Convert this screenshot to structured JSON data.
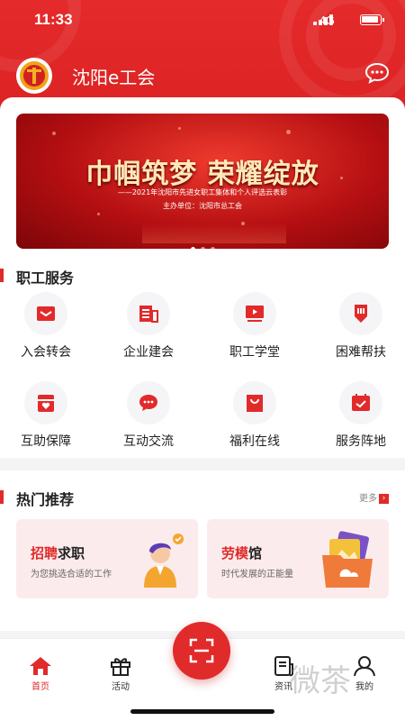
{
  "status_bar": {
    "time": "11:33",
    "network": "4G"
  },
  "header": {
    "title": "沈阳e工会",
    "icon": "message-icon"
  },
  "banner": {
    "headline": "巾帼筑梦 荣耀绽放",
    "subtitle": "——2021年沈阳市先进女职工集体和个人评选云表彰",
    "host": "主办单位：沈阳市总工会",
    "slides": 3,
    "active_slide": 1
  },
  "services": {
    "title": "职工服务",
    "items": [
      {
        "label": "入会转会",
        "icon": "membership-icon"
      },
      {
        "label": "企业建会",
        "icon": "enterprise-icon"
      },
      {
        "label": "职工学堂",
        "icon": "video-class-icon"
      },
      {
        "label": "困难帮扶",
        "icon": "assistance-icon"
      },
      {
        "label": "互助保障",
        "icon": "mutual-aid-icon"
      },
      {
        "label": "互动交流",
        "icon": "chat-icon"
      },
      {
        "label": "福利在线",
        "icon": "welfare-bag-icon"
      },
      {
        "label": "服务阵地",
        "icon": "service-site-icon"
      }
    ]
  },
  "hot": {
    "title": "热门推荐",
    "more": "更多",
    "cards": [
      {
        "title_red": "招聘",
        "title_dark": "求职",
        "desc": "为您挑选合适的工作",
        "icon": "job-seeker-illustration"
      },
      {
        "title_red": "劳模",
        "title_dark": "馆",
        "desc": "时代发展的正能量",
        "icon": "photo-folder-illustration"
      }
    ]
  },
  "tabbar": {
    "items": [
      {
        "label": "首页",
        "icon": "home-icon",
        "active": true
      },
      {
        "label": "活动",
        "icon": "gift-icon",
        "active": false
      },
      {
        "label": "资讯",
        "icon": "news-icon",
        "active": false
      },
      {
        "label": "我的",
        "icon": "profile-icon",
        "active": false
      }
    ],
    "center_icon": "scan-icon"
  },
  "colors": {
    "brand_red": "#e12a2a",
    "gold": "#f0a21a",
    "soft_pink": "#fcebec"
  },
  "watermark": "微茶"
}
